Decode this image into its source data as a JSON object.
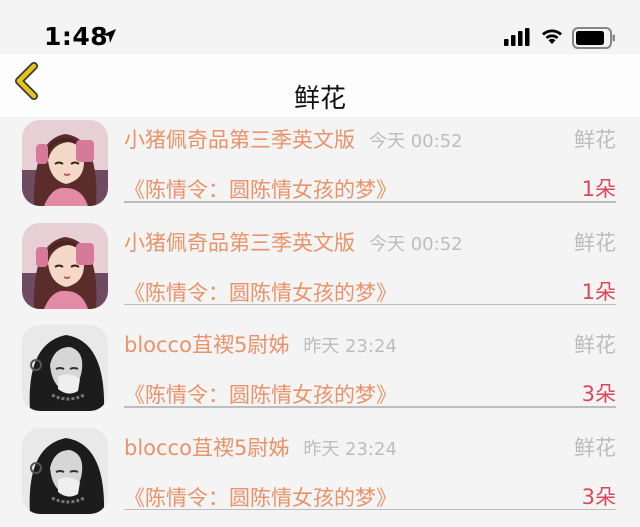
{
  "status_bar": {
    "time": "1:48",
    "icons": [
      "location-arrow-icon",
      "cellular-signal-icon",
      "wifi-icon",
      "battery-icon"
    ]
  },
  "nav": {
    "title": "鲜花",
    "back_icon": "chevron-left-icon",
    "accent_color": "#e3c51e"
  },
  "rows": [
    {
      "name": "小猪佩奇品第三季英文版",
      "time": "今天 00:52",
      "gift": "鲜花",
      "drama": "《陈情令：圆陈情女孩的梦》",
      "count": "1朵",
      "avatar": "anime-avatar"
    },
    {
      "name": "小猪佩奇品第三季英文版",
      "time": "今天 00:52",
      "gift": "鲜花",
      "drama": "《陈情令：圆陈情女孩的梦》",
      "count": "1朵",
      "avatar": "anime-avatar"
    },
    {
      "name": "blocco苴禊5尉姊",
      "time": "昨天 23:24",
      "gift": "鲜花",
      "drama": "《陈情令：圆陈情女孩的梦》",
      "count": "3朵",
      "avatar": "photo-avatar"
    },
    {
      "name": "blocco苴禊5尉姊",
      "time": "昨天 23:24",
      "gift": "鲜花",
      "drama": "《陈情令：圆陈情女孩的梦》",
      "count": "3朵",
      "avatar": "photo-avatar"
    }
  ],
  "colors": {
    "name": "#e8936a",
    "count": "#d9485a",
    "muted": "#bcbcbc"
  }
}
